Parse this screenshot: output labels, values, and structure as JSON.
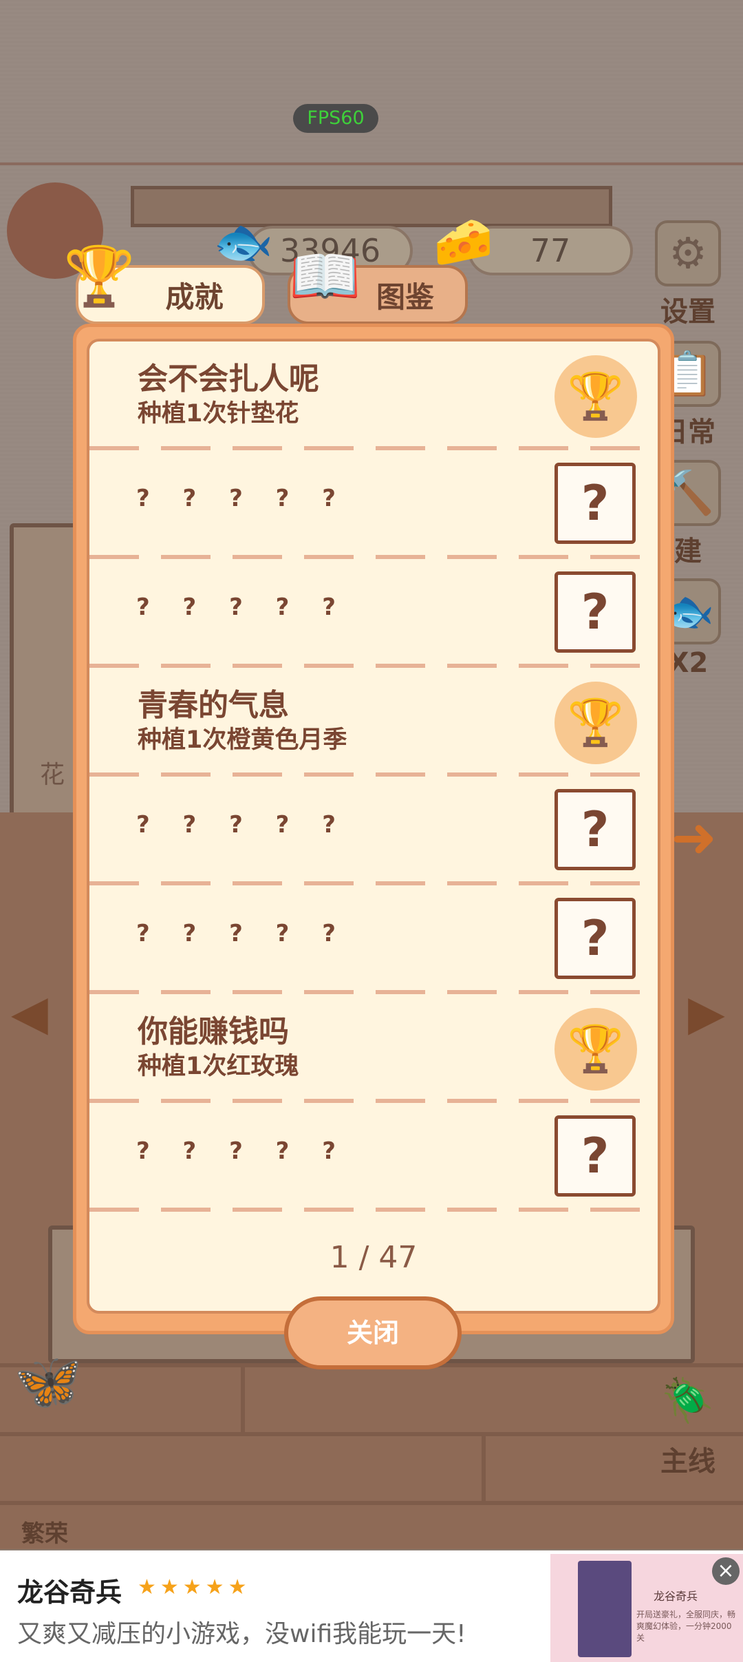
{
  "hud": {
    "fps": "FPS60",
    "fish_count": "33946",
    "cheese_count": "77"
  },
  "side_menu": {
    "settings": "设置",
    "daily": "日常",
    "build": "建",
    "bonus": "X2",
    "mainline": "主线",
    "bottom_left": "繁荣"
  },
  "background_sign": "花",
  "tabs": {
    "achievements": "成就",
    "atlas": "图鉴"
  },
  "achievements": [
    {
      "unlocked": true,
      "title": "会不会扎人呢",
      "desc": "种植1次针垫花"
    },
    {
      "unlocked": false,
      "title": "? ? ? ? ?",
      "desc": ""
    },
    {
      "unlocked": false,
      "title": "? ? ? ? ?",
      "desc": ""
    },
    {
      "unlocked": true,
      "title": "青春的气息",
      "desc": "种植1次橙黄色月季"
    },
    {
      "unlocked": false,
      "title": "? ? ? ? ?",
      "desc": ""
    },
    {
      "unlocked": false,
      "title": "? ? ? ? ?",
      "desc": ""
    },
    {
      "unlocked": true,
      "title": "你能赚钱吗",
      "desc": "种植1次红玫瑰"
    },
    {
      "unlocked": false,
      "title": "? ? ? ? ?",
      "desc": ""
    }
  ],
  "locked_glyph": "?",
  "pagination": "1 / 47",
  "close_label": "关闭",
  "ad": {
    "title": "龙谷奇兵",
    "stars": "★★★★★",
    "subtitle": "又爽又减压的小游戏，没wifi我能玩一天!",
    "mini_title": "龙谷奇兵",
    "mini_text": "开局送豪礼，全服同庆，畅爽魔幻体验，一分钟2000关",
    "close": "×"
  }
}
